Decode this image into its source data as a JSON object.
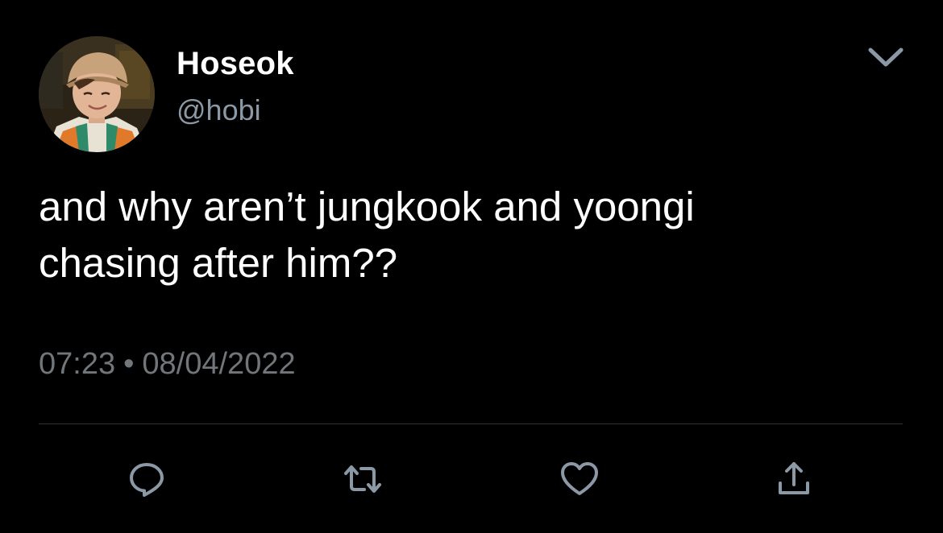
{
  "user": {
    "display_name": "Hoseok",
    "handle": "@hobi"
  },
  "tweet": {
    "text": "and why aren’t jungkook and yoongi\nchasing after him??",
    "time": "07:23",
    "separator": "•",
    "date": "08/04/2022"
  },
  "actions": [
    {
      "icon": "reply-icon"
    },
    {
      "icon": "retweet-icon"
    },
    {
      "icon": "like-icon"
    },
    {
      "icon": "share-icon"
    }
  ],
  "menu": {
    "icon": "chevron-down-icon"
  },
  "colors": {
    "background": "#000000",
    "primary_text": "#ffffff",
    "secondary_text": "#8b98a5",
    "icon": "#8b98a5",
    "divider": "#2f3336"
  }
}
